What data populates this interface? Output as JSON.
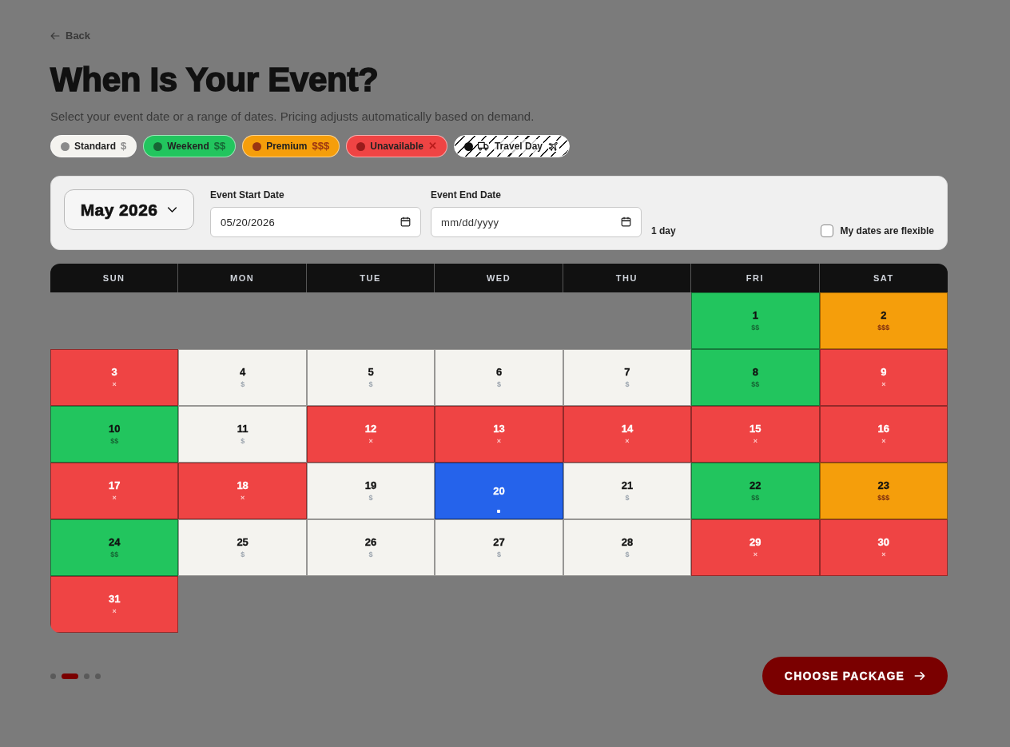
{
  "back_link": {
    "label": "Back"
  },
  "title": "When Is Your Event?",
  "subtitle": "Select your event date or a range of dates. Pricing adjusts automatically based on demand.",
  "legend": [
    {
      "kind": "standard",
      "label": "Standard",
      "symbol": "$",
      "color": "#8a8a8a"
    },
    {
      "kind": "weekend",
      "label": "Weekend",
      "symbol": "$$",
      "color": "#166534"
    },
    {
      "kind": "premium",
      "label": "Premium",
      "symbol": "$$$",
      "color": "#9a3412"
    },
    {
      "kind": "unavailable",
      "label": "Unavailable",
      "symbol": "✕",
      "color": "#991b1b"
    },
    {
      "kind": "travel",
      "label": "Travel Day",
      "color": "#111111"
    }
  ],
  "date_panel": {
    "month_picker": {
      "label": "May 2026"
    },
    "start_date": {
      "label": "Event Start Date",
      "value": "05/20/2026"
    },
    "end_date": {
      "label": "Event End Date",
      "placeholder": "mm/dd/yyyy"
    },
    "duration": "1 day",
    "flexible": {
      "label": "My dates are flexible",
      "checked": false
    }
  },
  "calendar": {
    "weekdays": [
      "SUN",
      "MON",
      "TUE",
      "WED",
      "THU",
      "FRI",
      "SAT"
    ],
    "weeks": [
      [
        {
          "kind": "blank"
        },
        {
          "kind": "blank"
        },
        {
          "kind": "blank"
        },
        {
          "kind": "blank"
        },
        {
          "kind": "blank"
        },
        {
          "day": "1",
          "kind": "weekend",
          "price": "$$",
          "selected": false
        },
        {
          "day": "2",
          "kind": "premium",
          "price": "$$$",
          "selected": false
        }
      ],
      [
        {
          "day": "3",
          "kind": "unavailable",
          "price": "×",
          "selected": false
        },
        {
          "day": "4",
          "kind": "standard",
          "price": "$",
          "selected": false
        },
        {
          "day": "5",
          "kind": "standard",
          "price": "$",
          "selected": false
        },
        {
          "day": "6",
          "kind": "standard",
          "price": "$",
          "selected": false
        },
        {
          "day": "7",
          "kind": "standard",
          "price": "$",
          "selected": false
        },
        {
          "day": "8",
          "kind": "weekend",
          "price": "$$",
          "selected": false
        },
        {
          "day": "9",
          "kind": "unavailable",
          "price": "×",
          "selected": false
        }
      ],
      [
        {
          "day": "10",
          "kind": "weekend",
          "price": "$$",
          "selected": false
        },
        {
          "day": "11",
          "kind": "standard",
          "price": "$",
          "selected": false
        },
        {
          "day": "12",
          "kind": "unavailable",
          "price": "×",
          "selected": false
        },
        {
          "day": "13",
          "kind": "unavailable",
          "price": "×",
          "selected": false
        },
        {
          "day": "14",
          "kind": "unavailable",
          "price": "×",
          "selected": false
        },
        {
          "day": "15",
          "kind": "unavailable",
          "price": "×",
          "selected": false
        },
        {
          "day": "16",
          "kind": "unavailable",
          "price": "×",
          "selected": false
        }
      ],
      [
        {
          "day": "17",
          "kind": "unavailable",
          "price": "×",
          "selected": false
        },
        {
          "day": "18",
          "kind": "unavailable",
          "price": "×",
          "selected": false
        },
        {
          "day": "19",
          "kind": "standard",
          "price": "$",
          "selected": false
        },
        {
          "day": "20",
          "selected": true
        },
        {
          "day": "21",
          "kind": "standard",
          "price": "$",
          "selected": false
        },
        {
          "day": "22",
          "kind": "weekend",
          "price": "$$",
          "selected": false
        },
        {
          "day": "23",
          "kind": "premium",
          "price": "$$$",
          "selected": false
        }
      ],
      [
        {
          "day": "24",
          "kind": "weekend",
          "price": "$$",
          "selected": false
        },
        {
          "day": "25",
          "kind": "standard",
          "price": "$",
          "selected": false
        },
        {
          "day": "26",
          "kind": "standard",
          "price": "$",
          "selected": false
        },
        {
          "day": "27",
          "kind": "standard",
          "price": "$",
          "selected": false
        },
        {
          "day": "28",
          "kind": "standard",
          "price": "$",
          "selected": false
        },
        {
          "day": "29",
          "kind": "unavailable",
          "price": "×",
          "selected": false
        },
        {
          "day": "30",
          "kind": "unavailable",
          "price": "×",
          "selected": false
        }
      ],
      [
        {
          "day": "31",
          "kind": "unavailable",
          "price": "×",
          "selected": false
        }
      ]
    ]
  },
  "progress_steps": [
    {
      "selected": false
    },
    {
      "selected": true
    },
    {
      "selected": false
    },
    {
      "selected": false
    }
  ],
  "next_button": {
    "label": "CHOOSE PACKAGE"
  }
}
